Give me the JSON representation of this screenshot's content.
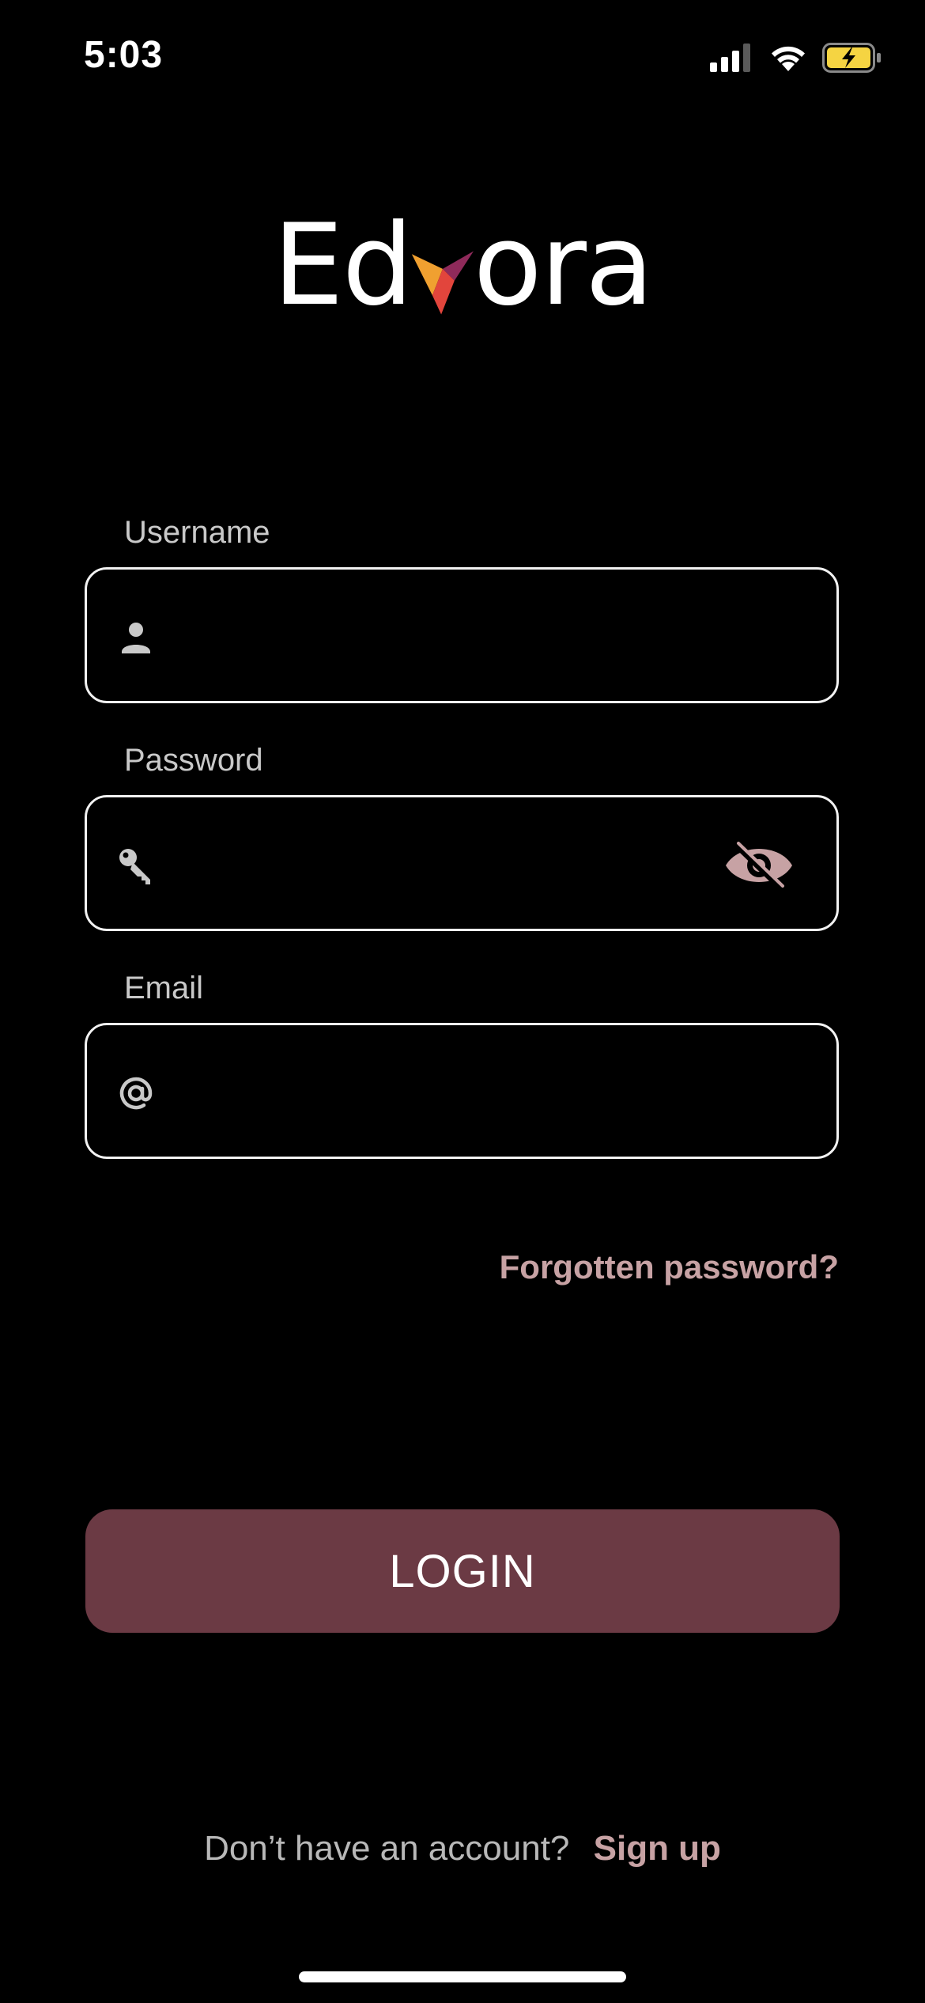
{
  "status_bar": {
    "time": "5:03",
    "icons": [
      "cellular-signal-icon",
      "wifi-icon",
      "battery-charging-icon"
    ],
    "battery_color": "#f5d442"
  },
  "logo": {
    "prefix": "Ed",
    "suffix": "ora",
    "mark_colors": [
      "#f0a030",
      "#e2453c",
      "#8f2a5a"
    ]
  },
  "form": {
    "username": {
      "label": "Username",
      "value": "",
      "icon": "person-icon"
    },
    "password": {
      "label": "Password",
      "value": "",
      "icon": "key-icon",
      "toggle_icon": "eye-slash-icon"
    },
    "email": {
      "label": "Email",
      "value": "",
      "icon": "at-sign-icon"
    },
    "forgot_password": "Forgotten password?",
    "login_button": "LOGIN"
  },
  "signup": {
    "prompt": "Don’t have an account?",
    "link": "Sign up"
  },
  "colors": {
    "accent": "#6b3a44",
    "link": "#c7a2a4",
    "background": "#000000"
  }
}
